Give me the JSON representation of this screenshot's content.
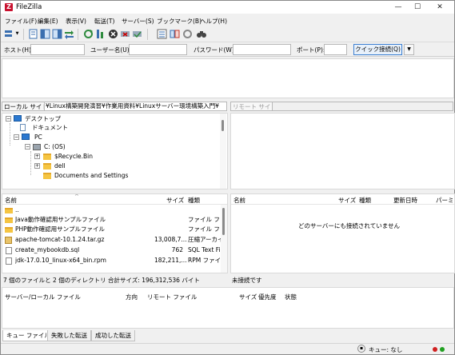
{
  "window": {
    "title": "FileZilla",
    "minimize": "—",
    "maximize": "☐",
    "close": "✕"
  },
  "menu": [
    "ファイル(F)",
    "編集(E)",
    "表示(V)",
    "転送(T)",
    "サーバー(S)",
    "ブックマーク(B)",
    "ヘルプ(H)"
  ],
  "quickconnect": {
    "host_label": "ホスト(H):",
    "user_label": "ユーザー名(U):",
    "password_label": "パスワード(W):",
    "port_label": "ポート(P):",
    "connect_button": "クイック接続(Q)",
    "dropdown": "▼"
  },
  "local": {
    "label": "ローカル サイト:",
    "path": "¥Linux構築開発演習¥作業用資料¥Linuxサーバー環境構築入門¥",
    "tree": [
      {
        "name": "デスクトップ",
        "icon": "desktop-icon"
      },
      {
        "name": "ドキュメント",
        "icon": "documents-icon"
      },
      {
        "name": "PC",
        "icon": "pc-icon"
      },
      {
        "name": "C: (OS)",
        "icon": "drive-icon"
      },
      {
        "name": "$Recycle.Bin",
        "icon": "folder-icon"
      },
      {
        "name": "dell",
        "icon": "folder-icon"
      },
      {
        "name": "Documents and Settings",
        "icon": "folder-shortcut-icon"
      }
    ],
    "columns": {
      "name": "名前",
      "size": "サイズ",
      "type": "種類"
    },
    "files": [
      {
        "name": "..",
        "size": "",
        "type": "",
        "icon": "folder-icon"
      },
      {
        "name": "Java動作確認用サンプルファイル",
        "size": "",
        "type": "ファイル フォル",
        "icon": "folder-icon"
      },
      {
        "name": "PHP動作確認用サンプルファイル",
        "size": "",
        "type": "ファイル フォル",
        "icon": "folder-icon"
      },
      {
        "name": "apache-tomcat-10.1.24.tar.gz",
        "size": "13,008,7...",
        "type": "圧縮アーカイ",
        "icon": "archive-icon"
      },
      {
        "name": "create_mybookdb.sql",
        "size": "762",
        "type": "SQL Text Fil",
        "icon": "file-icon"
      },
      {
        "name": "jdk-17.0.10_linux-x64_bin.rpm",
        "size": "182,211,...",
        "type": "RPM ファイル",
        "icon": "file-icon"
      }
    ],
    "status": "7 個のファイルと 2 個のディレクトリ 合計サイズ: 196,312,536 バイト"
  },
  "remote": {
    "label": "リモート サイト:",
    "path": "",
    "columns": {
      "name": "名前",
      "size": "サイズ",
      "type": "種類",
      "modified": "更新日時",
      "permission": "パーミッ"
    },
    "empty_message": "どのサーバーにも接続されていません",
    "status": "未接続です"
  },
  "queue": {
    "columns": {
      "file": "サーバー/ローカル ファイル",
      "direction": "方向",
      "remote_file": "リモート ファイル",
      "size": "サイズ",
      "priority": "優先度",
      "status": "状態"
    }
  },
  "tabs": [
    "キュー ファイル",
    "失敗した転送",
    "成功した転送"
  ],
  "statusbar": {
    "queue": "キュー: なし"
  },
  "colors": {
    "accent": "#3c7fd1",
    "led_red": "#d02020",
    "led_green": "#20a020"
  }
}
